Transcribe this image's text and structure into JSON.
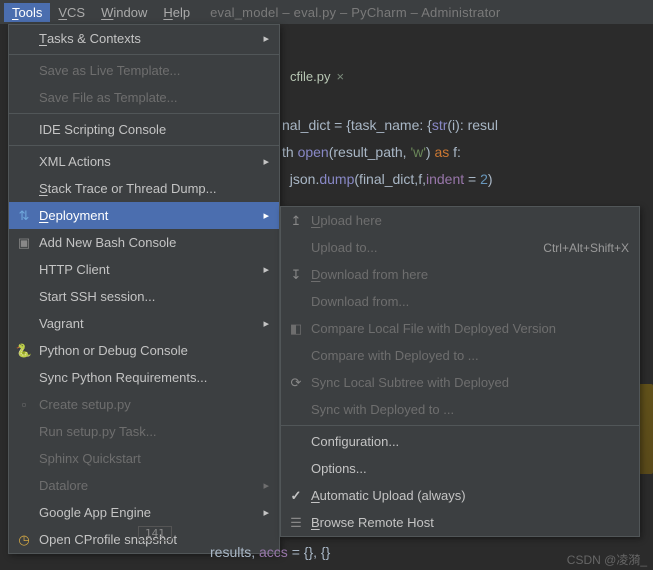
{
  "menubar": {
    "tools": "Tools",
    "vcs": "VCS",
    "window": "Window",
    "help": "Help",
    "title": "eval_model – eval.py – PyCharm – Administrator"
  },
  "tab": {
    "name": "cfile.py",
    "close_glyph": "×"
  },
  "code": {
    "l1": "nal_dict = {task_name: {",
    "l1b": "str",
    "l1c": "(i): resul",
    "l2a": "th ",
    "l2open": "open",
    "l2b": "(result_path, ",
    "l2str": "'w'",
    "l2c": ") ",
    "l2as": "as",
    "l2d": " f:",
    "l3a": "  json.",
    "l3dump": "dump",
    "l3b": "(final_dict,f,",
    "l3indent": "indent",
    "l3c": " = ",
    "l3num": "2",
    "l3d": ")"
  },
  "menu1": {
    "tasks": "Tasks & Contexts",
    "save_live": "Save as Live Template...",
    "save_file_tpl": "Save File as Template...",
    "ide_script": "IDE Scripting Console",
    "xml_actions": "XML Actions",
    "stack_trace": "Stack Trace or Thread Dump...",
    "deployment": "Deployment",
    "bash": "Add New Bash Console",
    "http_client": "HTTP Client",
    "ssh": "Start SSH session...",
    "vagrant": "Vagrant",
    "py_console": "Python or Debug Console",
    "sync_req": "Sync Python Requirements...",
    "create_setup": "Create setup.py",
    "run_setup": "Run setup.py Task...",
    "sphinx": "Sphinx Quickstart",
    "datalore": "Datalore",
    "gae": "Google App Engine",
    "cprofile": "Open CProfile snapshot"
  },
  "menu2": {
    "upload_here": "Upload here",
    "upload_to": "Upload to...",
    "upload_to_shortcut": "Ctrl+Alt+Shift+X",
    "download_here": "Download from here",
    "download_from": "Download from...",
    "compare_local": "Compare Local File with Deployed Version",
    "compare_to": "Compare with Deployed to ...",
    "sync_local": "Sync Local Subtree with Deployed",
    "sync_to": "Sync with Deployed to ...",
    "config": "Configuration...",
    "options": "Options...",
    "auto_upload": "Automatic Upload (always)",
    "browse_remote": "Browse Remote Host"
  },
  "gutter": {
    "lineno": "141"
  },
  "bottom": {
    "text_a": "results, ",
    "accs": "accs",
    "text_b": " = {}, {}"
  },
  "watermark": "CSDN @凌漪_"
}
